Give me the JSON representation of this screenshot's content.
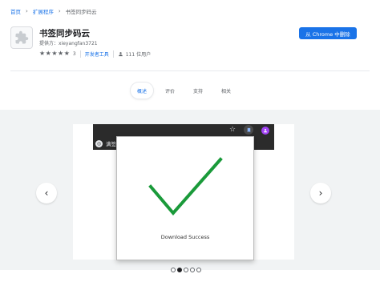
{
  "breadcrumb": {
    "home": "首页",
    "extensions": "扩展程序",
    "current": "书签同步码云"
  },
  "extension": {
    "title": "书签同步码云",
    "provider": "提供方：xieyangfan3721",
    "rating": 5,
    "rating_count": "3",
    "category": "开发者工具",
    "users": "111 位用户"
  },
  "actions": {
    "add_button": "从 Chrome 中删除"
  },
  "tabs": [
    "概述",
    "评价",
    "支持",
    "相关"
  ],
  "active_tab": 0,
  "screenshot": {
    "site_label": "满签",
    "message": "Download Success",
    "check_color": "#1a9a3a"
  },
  "carousel": {
    "slide_count": 5,
    "active_index": 1
  },
  "colors": {
    "accent": "#1a73e8"
  }
}
